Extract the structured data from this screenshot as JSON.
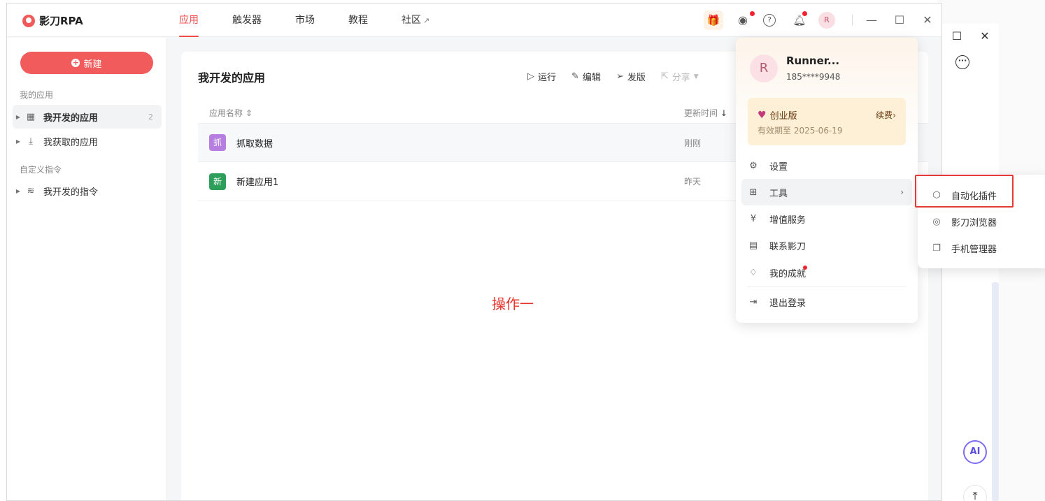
{
  "app": {
    "logo_text": "影刀RPA",
    "nav": [
      "应用",
      "触发器",
      "市场",
      "教程",
      "社区"
    ],
    "avatar_letter": "R"
  },
  "sidebar": {
    "new_button": "新建",
    "section_my_apps": "我的应用",
    "item_developed": "我开发的应用",
    "item_developed_count": "2",
    "item_obtained": "我获取的应用",
    "section_custom": "自定义指令",
    "item_my_commands": "我开发的指令"
  },
  "content": {
    "title": "我开发的应用",
    "actions": {
      "run": "运行",
      "edit": "编辑",
      "publish": "发版",
      "share": "分享"
    },
    "columns": {
      "name": "应用名称",
      "updated": "更新时间"
    },
    "rows": [
      {
        "icon_char": "抓",
        "icon_color": "#b57ee0",
        "name": "抓取数据",
        "time": "刚刚"
      },
      {
        "icon_char": "新",
        "icon_color": "#2e9e5b",
        "name": "新建应用1",
        "time": "昨天"
      }
    ],
    "annotation": "操作一"
  },
  "user_menu": {
    "name": "Runner...",
    "phone": "185****9948",
    "avatar_letter": "R",
    "plan_name": "创业版",
    "plan_expiry": "有效期至 2025-06-19",
    "renew": "续费",
    "items": {
      "settings": "设置",
      "tools": "工具",
      "value_added": "增值服务",
      "contact": "联系影刀",
      "achievements": "我的成就",
      "logout": "退出登录"
    }
  },
  "tools_submenu": {
    "automation_plugin": "自动化插件",
    "browser": "影刀浏览器",
    "phone_manager": "手机管理器"
  },
  "colors": {
    "accent": "#f04b4b",
    "highlight_box": "#e53935"
  }
}
